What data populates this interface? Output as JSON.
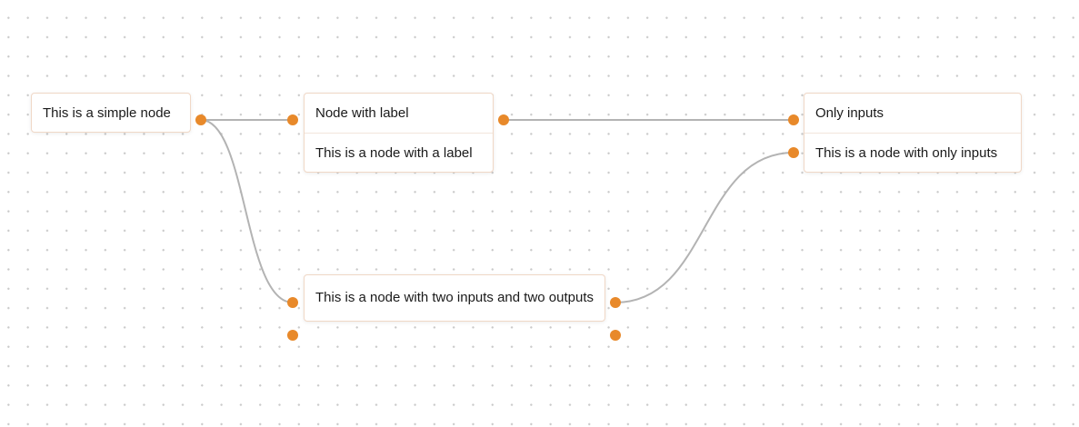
{
  "colors": {
    "background": "#ffffff",
    "grid_dot": "#c9c9c9",
    "edge": "#b3b3b3",
    "port": "#e8892a",
    "node_border": "#f0d8c6"
  },
  "nodes": {
    "simple": {
      "text": "This is a simple node"
    },
    "labeled": {
      "label": "Node with label",
      "text": "This is a node with a label"
    },
    "inputs_only": {
      "label": "Only inputs",
      "text": "This is a node with only inputs"
    },
    "two_io": {
      "text": "This is a node with two inputs and two outputs"
    }
  },
  "edges": [
    {
      "from": "simple.output",
      "to": "labeled.input"
    },
    {
      "from": "labeled.output",
      "to": "inputs_only.input_1"
    },
    {
      "from": "simple.output",
      "to": "two_io.input_1"
    },
    {
      "from": "two_io.output_1",
      "to": "inputs_only.input_2"
    }
  ]
}
